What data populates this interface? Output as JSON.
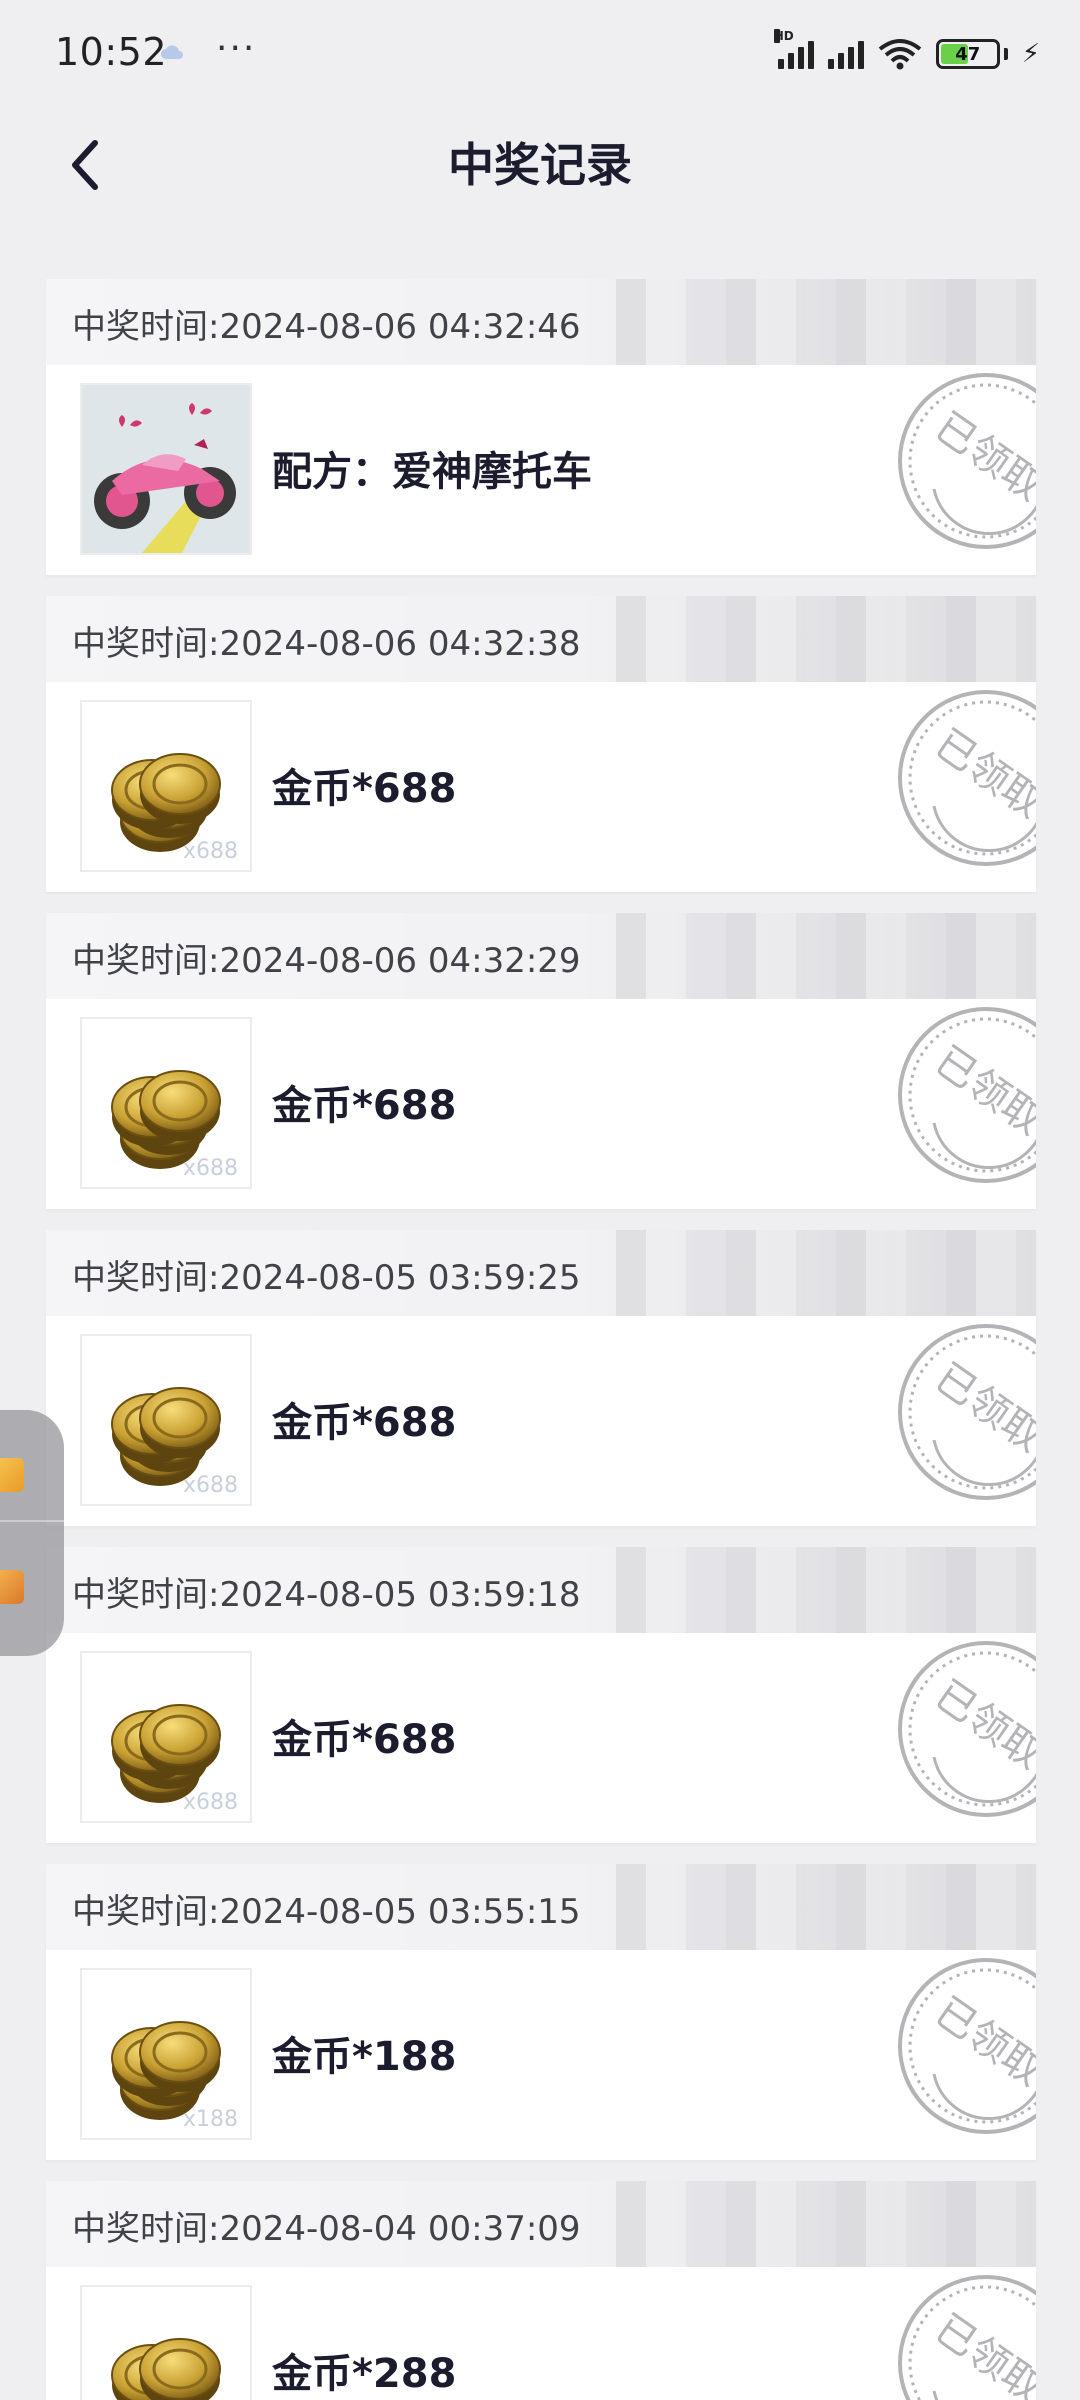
{
  "status_bar": {
    "time": "10:52",
    "dots": "···",
    "hd": "HD",
    "battery": 47
  },
  "header": {
    "title": "中奖记录"
  },
  "records": [
    {
      "time": "中奖时间:2024-08-06 04:32:46",
      "prize": "配方：爱神摩托车",
      "thumb": "pink-motorcycle",
      "qty": "",
      "status": "已领取"
    },
    {
      "time": "中奖时间:2024-08-06 04:32:38",
      "prize": "金币*688",
      "thumb": "gold-coins",
      "qty": "x688",
      "status": "已领取"
    },
    {
      "time": "中奖时间:2024-08-06 04:32:29",
      "prize": "金币*688",
      "thumb": "gold-coins",
      "qty": "x688",
      "status": "已领取"
    },
    {
      "time": "中奖时间:2024-08-05 03:59:25",
      "prize": "金币*688",
      "thumb": "gold-coins",
      "qty": "x688",
      "status": "已领取"
    },
    {
      "time": "中奖时间:2024-08-05 03:59:18",
      "prize": "金币*688",
      "thumb": "gold-coins",
      "qty": "x688",
      "status": "已领取"
    },
    {
      "time": "中奖时间:2024-08-05 03:55:15",
      "prize": "金币*188",
      "thumb": "gold-coins",
      "qty": "x188",
      "status": "已领取"
    },
    {
      "time": "中奖时间:2024-08-04 00:37:09",
      "prize": "金币*288",
      "thumb": "gold-coins",
      "qty": "",
      "status": "已领取"
    }
  ],
  "colors": {
    "background": "#efeff1",
    "text": "#1b1d2e",
    "stamp": "#b4b4b8",
    "coin": "#c9a133",
    "battery": "#6ad04a"
  }
}
